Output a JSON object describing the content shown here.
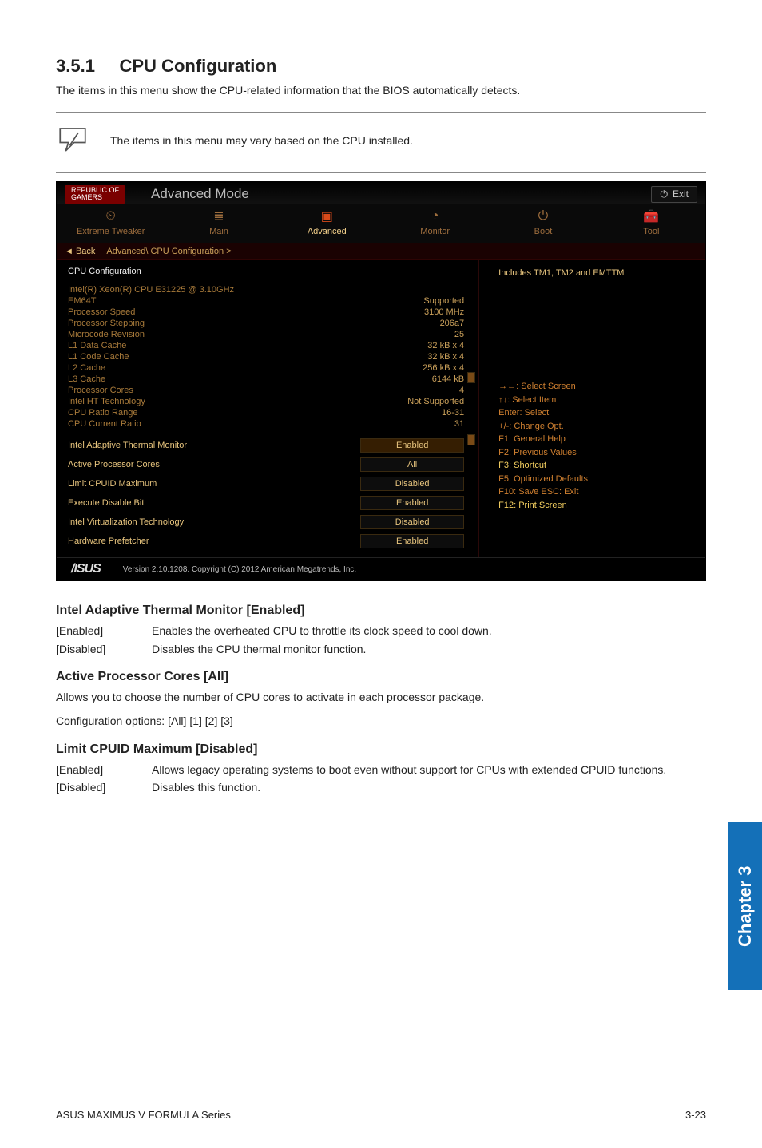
{
  "section": {
    "number": "3.5.1",
    "title": "CPU Configuration",
    "intro": "The items in this menu show the CPU-related information that the BIOS automatically detects.",
    "note": "The items in this menu may vary based on the CPU installed."
  },
  "bios": {
    "brand_top": "REPUBLIC OF",
    "brand_bottom": "GAMERS",
    "mode": "Advanced Mode",
    "exit": "Exit",
    "tabs": {
      "extreme": "Extreme Tweaker",
      "main": "Main",
      "advanced": "Advanced",
      "monitor": "Monitor",
      "boot": "Boot",
      "tool": "Tool"
    },
    "breadcrumb_back": "Back",
    "breadcrumb_path": "Advanced\\ CPU Configuration >",
    "panel_title": "CPU Configuration",
    "info": [
      {
        "l": "Intel(R) Xeon(R) CPU E31225 @ 3.10GHz",
        "v": ""
      },
      {
        "l": "EM64T",
        "v": "Supported"
      },
      {
        "l": "Processor Speed",
        "v": "3100 MHz"
      },
      {
        "l": "Processor Stepping",
        "v": "206a7"
      },
      {
        "l": "Microcode Revision",
        "v": "25"
      },
      {
        "l": "L1 Data Cache",
        "v": "32 kB x 4"
      },
      {
        "l": "L1 Code Cache",
        "v": "32 kB x 4"
      },
      {
        "l": "L2 Cache",
        "v": "256 kB x 4"
      },
      {
        "l": "L3 Cache",
        "v": "6144 kB"
      },
      {
        "l": "Processor Cores",
        "v": "4"
      },
      {
        "l": "Intel HT Technology",
        "v": "Not Supported"
      },
      {
        "l": "CPU Ratio Range",
        "v": "16-31"
      },
      {
        "l": "CPU Current Ratio",
        "v": "31"
      }
    ],
    "opts": [
      {
        "l": "Intel Adaptive Thermal Monitor",
        "v": "Enabled",
        "sel": true
      },
      {
        "l": "Active Processor Cores",
        "v": "All"
      },
      {
        "l": "Limit CPUID Maximum",
        "v": "Disabled"
      },
      {
        "l": "Execute Disable Bit",
        "v": "Enabled"
      },
      {
        "l": "Intel Virtualization Technology",
        "v": "Disabled"
      },
      {
        "l": "Hardware Prefetcher",
        "v": "Enabled"
      }
    ],
    "side_help": "Includes TM1, TM2 and EMTTM",
    "keys": {
      "nav": "→←: Select Screen",
      "item": "↑↓: Select Item",
      "enter": "Enter: Select",
      "change": "+/-: Change Opt.",
      "f1": "F1: General Help",
      "f2": "F2: Previous Values",
      "f3": "F3: Shortcut",
      "f5": "F5: Optimized Defaults",
      "f10": "F10: Save  ESC: Exit",
      "f12": "F12: Print Screen"
    },
    "footer_brand": "/ISUS",
    "footer_text": "Version 2.10.1208. Copyright (C) 2012 American Megatrends, Inc."
  },
  "settings": [
    {
      "heading": "Intel Adaptive Thermal Monitor [Enabled]",
      "rows": [
        {
          "k": "[Enabled]",
          "d": "Enables the overheated CPU to throttle its clock speed to cool down."
        },
        {
          "k": "[Disabled]",
          "d": "Disables the CPU thermal monitor function."
        }
      ]
    },
    {
      "heading": "Active Processor Cores [All]",
      "desc": "Allows you to choose the number of CPU cores to activate in each processor package.",
      "desc2": "Configuration options: [All] [1] [2] [3]"
    },
    {
      "heading": "Limit CPUID Maximum [Disabled]",
      "rows": [
        {
          "k": "[Enabled]",
          "d": "Allows legacy operating systems to boot even without support for CPUs with extended CPUID functions."
        },
        {
          "k": "[Disabled]",
          "d": "Disables this function."
        }
      ]
    }
  ],
  "chapter_tab": "Chapter 3",
  "footer": {
    "left": "ASUS MAXIMUS V FORMULA Series",
    "right": "3-23"
  }
}
